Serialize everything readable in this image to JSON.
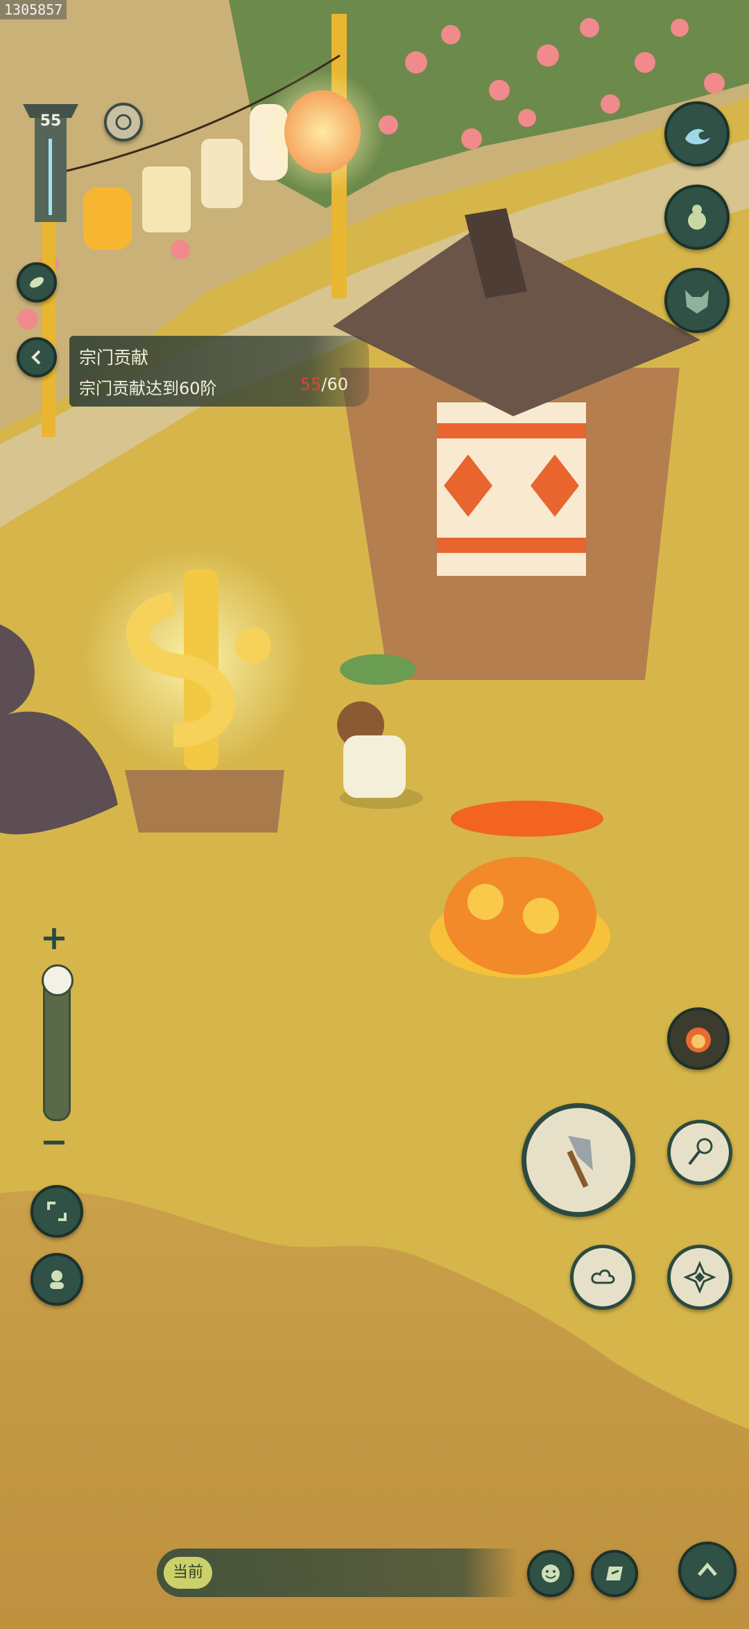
{
  "top_left": {
    "user_id": "1305857",
    "level": "55"
  },
  "quest": {
    "title": "宗门贡献",
    "description": "宗门贡献达到60阶",
    "progress_current": "55",
    "progress_separator": "/",
    "progress_total": "60"
  },
  "zoom": {
    "plus": "+",
    "minus": "−",
    "level": 0.0
  },
  "chat": {
    "channel_label": "当前"
  },
  "icons": {
    "right_top": [
      "wave-icon",
      "gourd-icon",
      "demon-mask-icon"
    ],
    "actions": [
      "lion-dance-icon",
      "axe-icon",
      "net-icon",
      "cloud-icon",
      "shuriken-icon"
    ],
    "left": [
      "back-arrow-icon",
      "leaf-icon",
      "expand-icon",
      "character-icon",
      "refresh-icon"
    ],
    "bottom": [
      "emoji-icon",
      "quick-chat-icon",
      "up-arrow-icon"
    ]
  },
  "colors": {
    "ground": "#d6b64a",
    "button_green": "#2f5146",
    "progress_red": "#d9453a"
  }
}
